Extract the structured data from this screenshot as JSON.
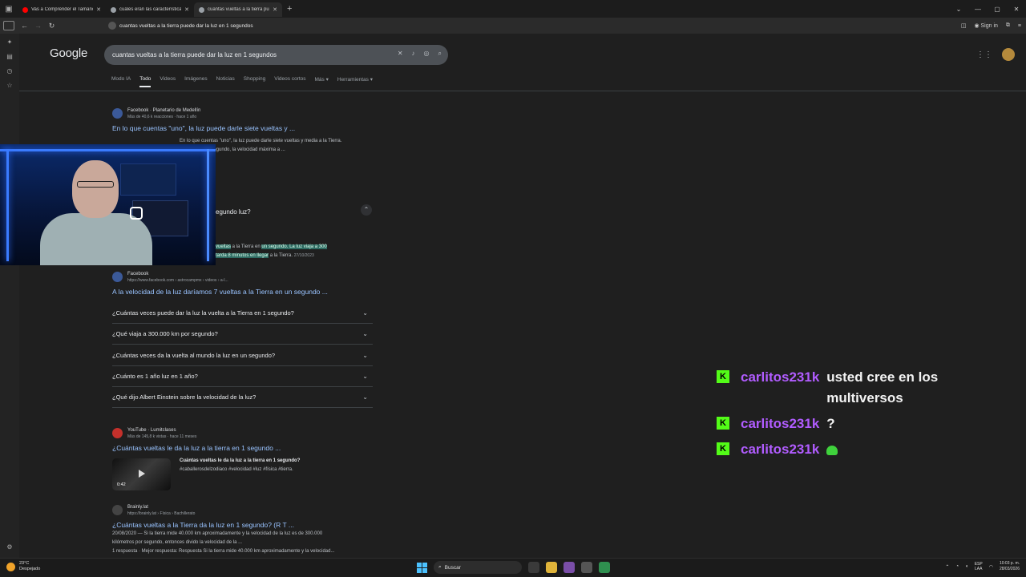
{
  "browser": {
    "tabs": [
      {
        "label": "Vas a Comprender el Tamaño de",
        "favicon_color": "#ff0000",
        "active": false
      },
      {
        "label": "cuáles eran las características d",
        "favicon_color": "#9aa0a6",
        "active": false
      },
      {
        "label": "cuantas vueltas a la tierra pue",
        "favicon_color": "#9aa0a6",
        "active": true
      }
    ],
    "new_tab": "+",
    "url": "cuantas vueltas a la tierra puede dar la luz en 1 segundos",
    "sign_in": "Sign in"
  },
  "google": {
    "logo": "Google",
    "query": "cuantas vueltas a la tierra puede dar la luz en 1 segundos",
    "tabs": [
      "Modo IA",
      "Todo",
      "Videos",
      "Imágenes",
      "Noticias",
      "Shopping",
      "Videos cortos",
      "Más ▾",
      "Herramientas ▾"
    ],
    "active_tab": "Todo"
  },
  "results": {
    "r1": {
      "source": "Facebook · Planetario de Medellín",
      "meta": "Más de 40,6 k reacciones · hace 1 año",
      "title": "En lo que cuentas \"uno\", la luz puede darle siete vueltas y ...",
      "snippet1": "En lo que cuentas \"uno\", la luz puede darle siete vueltas y media a la Tierra.",
      "snippet2": "kilómetros por segundo, la velocidad máxima a ..."
    },
    "featured": {
      "question_tail": "egundo luz?",
      "hl1a": "vueltas",
      "text1": " a la Tierra en ",
      "hl1b": "un segundo. La luz viaja a 300",
      "hl2": "tarda 8 minutos en llegar",
      "text2": " a la Tierra. ",
      "date": "27/10/2023"
    },
    "r2": {
      "source": "Facebook",
      "meta": "https://www.facebook.com › astrocampmx › videos › a-l...",
      "title": "A la velocidad de la luz daríamos 7 vueltas a la Tierra en un segundo ..."
    },
    "paa": [
      "¿Cuántas veces puede dar la luz la vuelta a la Tierra en 1 segundo?",
      "¿Qué viaja a 300.000 km por segundo?",
      "¿Cuántas veces da la vuelta al mundo la luz en un segundo?",
      "¿Cuánto es 1 año luz en 1 año?",
      "¿Qué dijo Albert Einstein sobre la velocidad de la luz?"
    ],
    "r3": {
      "source": "YouTube · Lumitclases",
      "meta": "Más de 145,8 k vistas · hace 11 meses",
      "title": "¿Cuántas vueltas le da la luz a la tierra en 1 segundo ...",
      "snippet1": "Cuántas vueltas le da la luz a la tierra en 1 segundo?",
      "snippet2": "#caballerosdelzodiaco #velocidad #luz #física #tierra.",
      "duration": "0:42"
    },
    "r4": {
      "source": "Brainly.lat",
      "meta": "https://brainly.lat › Física › Bachillerato",
      "title": "¿Cuántas vueltas a la Tierra da la luz en 1 segundo? (R T ...",
      "snippet1": "20/08/2020 — Si la tierra mide 40.000 km aproximadamente y la velocidad de la luz es de 300.000",
      "snippet2": "kilómetros por segundo, entonces divido la velocidad de la ...",
      "snippet3": "1 respuesta · Mejor respuesta: Respuesta Si la tierra mide 40.000 km aproximadamente y la velocidad..."
    }
  },
  "chat": [
    {
      "badge": "K",
      "user": "carlitos231k",
      "message": "usted cree en los multiversos"
    },
    {
      "badge": "K",
      "user": "carlitos231k",
      "message": "?"
    },
    {
      "badge": "K",
      "user": "carlitos231k",
      "message": ""
    }
  ],
  "taskbar": {
    "temp": "23°C",
    "weather": "Despejado",
    "search": "Buscar",
    "lang1": "ESP",
    "lang2": "LAA",
    "time": "10:03 p. m.",
    "date": "28/03/2026"
  },
  "colors": {
    "kick_green": "#53fc18",
    "chat_user": "#b15cff",
    "link": "#99c3ff"
  }
}
